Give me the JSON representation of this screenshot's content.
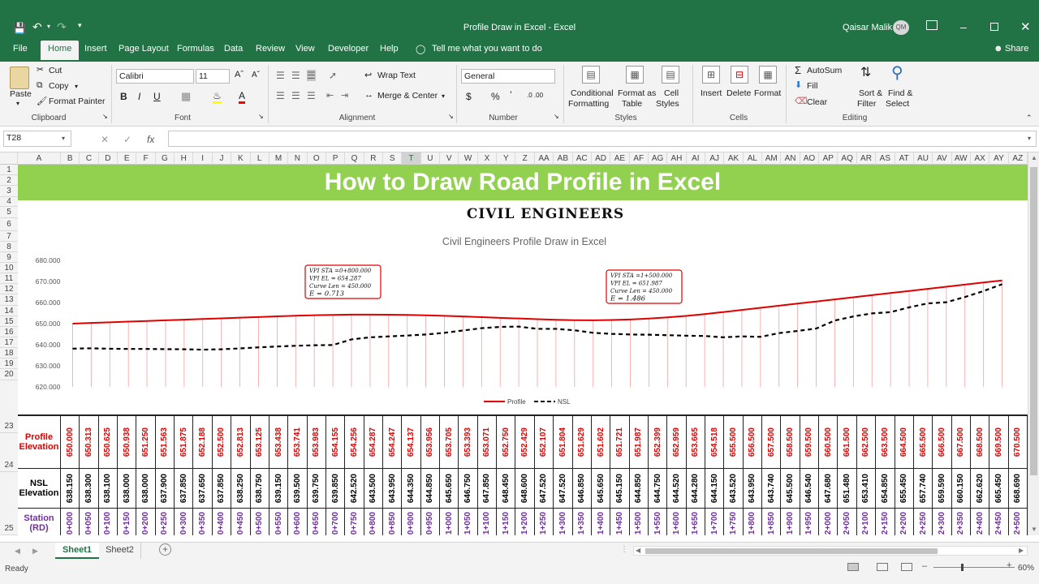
{
  "window": {
    "title": "Profile Draw in Excel  -  Excel",
    "user": "Qaisar Malik",
    "user_initials": "QM"
  },
  "tabs": [
    "File",
    "Home",
    "Insert",
    "Page Layout",
    "Formulas",
    "Data",
    "Review",
    "View",
    "Developer",
    "Help"
  ],
  "tell_me": "Tell me what you want to do",
  "share": "Share",
  "ribbon": {
    "clipboard": {
      "paste": "Paste",
      "cut": "Cut",
      "copy": "Copy",
      "format_painter": "Format Painter",
      "label": "Clipboard"
    },
    "font": {
      "name": "Calibri",
      "size": "11",
      "label": "Font"
    },
    "alignment": {
      "wrap": "Wrap Text",
      "merge": "Merge & Center",
      "label": "Alignment"
    },
    "number": {
      "format": "General",
      "label": "Number"
    },
    "styles": {
      "conditional": "Conditional",
      "formatting": "Formatting",
      "format_as": "Format as",
      "table": "Table",
      "cell": "Cell",
      "styles": "Styles",
      "label": "Styles"
    },
    "cells": {
      "insert": "Insert",
      "delete": "Delete",
      "format": "Format",
      "label": "Cells"
    },
    "editing": {
      "autosum": "AutoSum",
      "fill": "Fill",
      "clear": "Clear",
      "sort": "Sort &",
      "filter": "Filter",
      "find": "Find &",
      "select": "Select",
      "label": "Editing"
    }
  },
  "name_box": "T28",
  "formula_fx": "fx",
  "columns": [
    "A",
    "B",
    "C",
    "D",
    "E",
    "F",
    "G",
    "H",
    "I",
    "J",
    "K",
    "L",
    "M",
    "N",
    "O",
    "P",
    "Q",
    "R",
    "S",
    "T",
    "U",
    "V",
    "W",
    "X",
    "Y",
    "Z",
    "AA",
    "AB",
    "AC",
    "AD",
    "AE",
    "AF",
    "AG",
    "AH",
    "AI",
    "AJ",
    "AK",
    "AL",
    "AM",
    "AN",
    "AO",
    "AP",
    "AQ",
    "AR",
    "AS",
    "AT",
    "AU",
    "AV",
    "AW",
    "AX",
    "AY",
    "AZ"
  ],
  "rows": [
    "1",
    "2",
    "3",
    "4",
    "5",
    "6",
    "7",
    "8",
    "9",
    "10",
    "11",
    "12",
    "13",
    "14",
    "15",
    "16",
    "17",
    "18",
    "19",
    "20",
    "23",
    "24",
    "25"
  ],
  "sheet": {
    "banner": "How to Draw Road Profile in Excel",
    "subtitle": "CIVIL ENGINEERS",
    "row_labels": {
      "profile": "Profile Elevation",
      "nsl": "NSL Elevation",
      "station": "Station (RD)"
    },
    "colors": {
      "banner": "#92d050",
      "profile": "#e00000",
      "nsl": "#000000",
      "station": "#7030a0"
    }
  },
  "chart_data": {
    "type": "line",
    "title": "Civil Engineers Profile Draw in Excel",
    "x": [
      "0+000",
      "0+050",
      "0+100",
      "0+150",
      "0+200",
      "0+250",
      "0+300",
      "0+350",
      "0+400",
      "0+450",
      "0+500",
      "0+550",
      "0+600",
      "0+650",
      "0+700",
      "0+750",
      "0+800",
      "0+850",
      "0+900",
      "0+950",
      "1+000",
      "1+050",
      "1+100",
      "1+150",
      "1+200",
      "1+250",
      "1+300",
      "1+350",
      "1+400",
      "1+450",
      "1+500",
      "1+550",
      "1+600",
      "1+650",
      "1+700",
      "1+750",
      "1+800",
      "1+850",
      "1+900",
      "1+950",
      "2+000",
      "2+050",
      "2+100",
      "2+150",
      "2+200",
      "2+250",
      "2+300",
      "2+350",
      "2+400",
      "2+450",
      "2+500"
    ],
    "series": [
      {
        "name": "Profile",
        "color": "#e00000",
        "dash": "solid",
        "values": [
          "650.000",
          "650.313",
          "650.625",
          "650.938",
          "651.250",
          "651.563",
          "651.875",
          "652.188",
          "652.500",
          "652.813",
          "653.125",
          "653.438",
          "653.741",
          "653.983",
          "654.155",
          "654.256",
          "654.287",
          "654.247",
          "654.137",
          "653.956",
          "653.705",
          "653.393",
          "653.071",
          "652.750",
          "652.429",
          "652.107",
          "651.804",
          "651.629",
          "651.602",
          "651.721",
          "651.987",
          "652.399",
          "652.959",
          "653.665",
          "654.518",
          "655.500",
          "656.500",
          "657.500",
          "658.500",
          "659.500",
          "660.500",
          "661.500",
          "662.500",
          "663.500",
          "664.500",
          "665.500",
          "666.500",
          "667.500",
          "668.500",
          "669.500",
          "670.500"
        ]
      },
      {
        "name": "NSL",
        "color": "#000000",
        "dash": "dash",
        "values": [
          "638.150",
          "638.300",
          "638.100",
          "638.000",
          "638.000",
          "637.900",
          "637.850",
          "637.650",
          "637.850",
          "638.250",
          "638.750",
          "639.150",
          "639.500",
          "639.750",
          "639.850",
          "642.520",
          "643.500",
          "643.950",
          "644.350",
          "644.850",
          "645.650",
          "646.750",
          "647.850",
          "648.450",
          "648.600",
          "647.520",
          "647.520",
          "646.850",
          "645.650",
          "645.150",
          "644.850",
          "644.750",
          "644.520",
          "644.280",
          "644.150",
          "643.520",
          "643.950",
          "643.740",
          "645.500",
          "646.540",
          "647.680",
          "651.480",
          "653.410",
          "654.850",
          "655.450",
          "657.740",
          "659.590",
          "660.150",
          "662.620",
          "665.450",
          "668.690"
        ]
      }
    ],
    "ylim": [
      620,
      680
    ],
    "yticks": [
      "680.000",
      "670.000",
      "660.000",
      "650.000",
      "640.000",
      "630.000",
      "620.000"
    ],
    "legend": "bottom",
    "annotations": [
      {
        "sta": "VPI STA  =0+800.000",
        "el": "VPI EL     =  654.287",
        "len": "Curve Len = 450.000",
        "e": "E  =  0.713"
      },
      {
        "sta": "VPI STA  =1+500.000",
        "el": "VPI EL     =  651.987",
        "len": "Curve Len = 450.000",
        "e": "E  =  1.486"
      }
    ]
  },
  "sheets": [
    "Sheet1",
    "Sheet2"
  ],
  "status": {
    "ready": "Ready",
    "zoom": "60%"
  }
}
